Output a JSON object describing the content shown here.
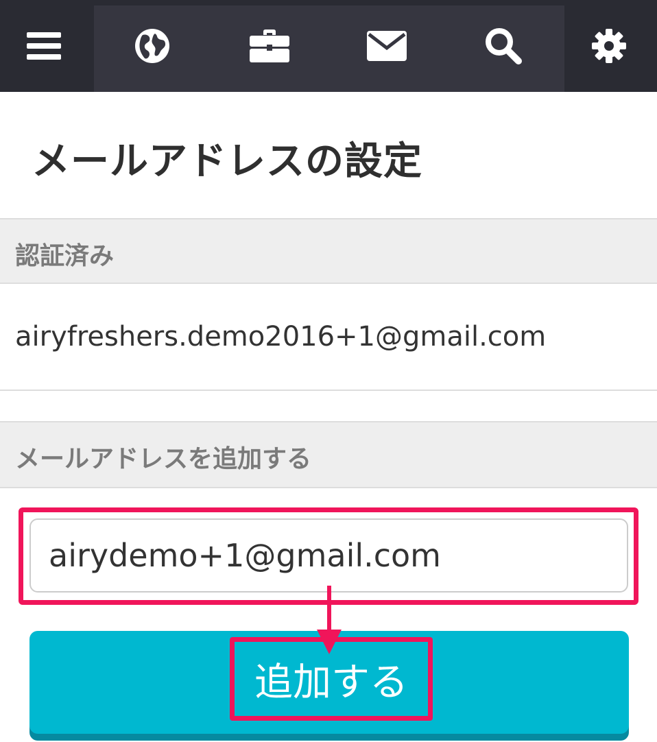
{
  "nav": {
    "icons": [
      "menu-icon",
      "globe-icon",
      "briefcase-icon",
      "mail-icon",
      "search-icon",
      "gear-icon"
    ]
  },
  "page": {
    "title": "メールアドレスの設定"
  },
  "verified": {
    "header": "認証済み",
    "email": "airyfreshers.demo2016+1@gmail.com"
  },
  "add": {
    "header": "メールアドレスを追加する",
    "input_value": "airydemo+1@gmail.com",
    "button_label": "追加する"
  },
  "colors": {
    "nav_bg": "#2a2b33",
    "accent": "#00b8d0",
    "highlight": "#f0155a"
  }
}
